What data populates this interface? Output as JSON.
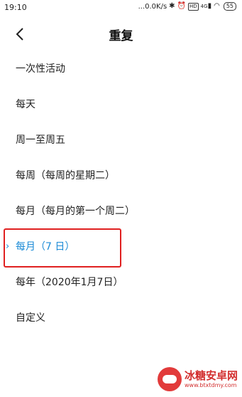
{
  "status_bar": {
    "time": "19:10",
    "net_speed": "...0.0K/s",
    "hd_badge": "HD",
    "signal": "4G",
    "battery": "55"
  },
  "header": {
    "back_icon": "chevron-left-icon",
    "title": "重复"
  },
  "options": [
    {
      "label": "一次性活动",
      "selected": false
    },
    {
      "label": "每天",
      "selected": false
    },
    {
      "label": "周一至周五",
      "selected": false
    },
    {
      "label": "每周（每周的星期二）",
      "selected": false
    },
    {
      "label": "每月（每月的第一个周二）",
      "selected": false
    },
    {
      "label": "每月（7 日）",
      "selected": true
    },
    {
      "label": "每年（2020年1月7日）",
      "selected": false
    },
    {
      "label": "自定义",
      "selected": false
    }
  ],
  "colors": {
    "accent": "#1a8ad6",
    "highlight": "#e02020"
  },
  "watermark": {
    "name": "冰糖安卓网",
    "url": "www.btxtdmy.com"
  }
}
